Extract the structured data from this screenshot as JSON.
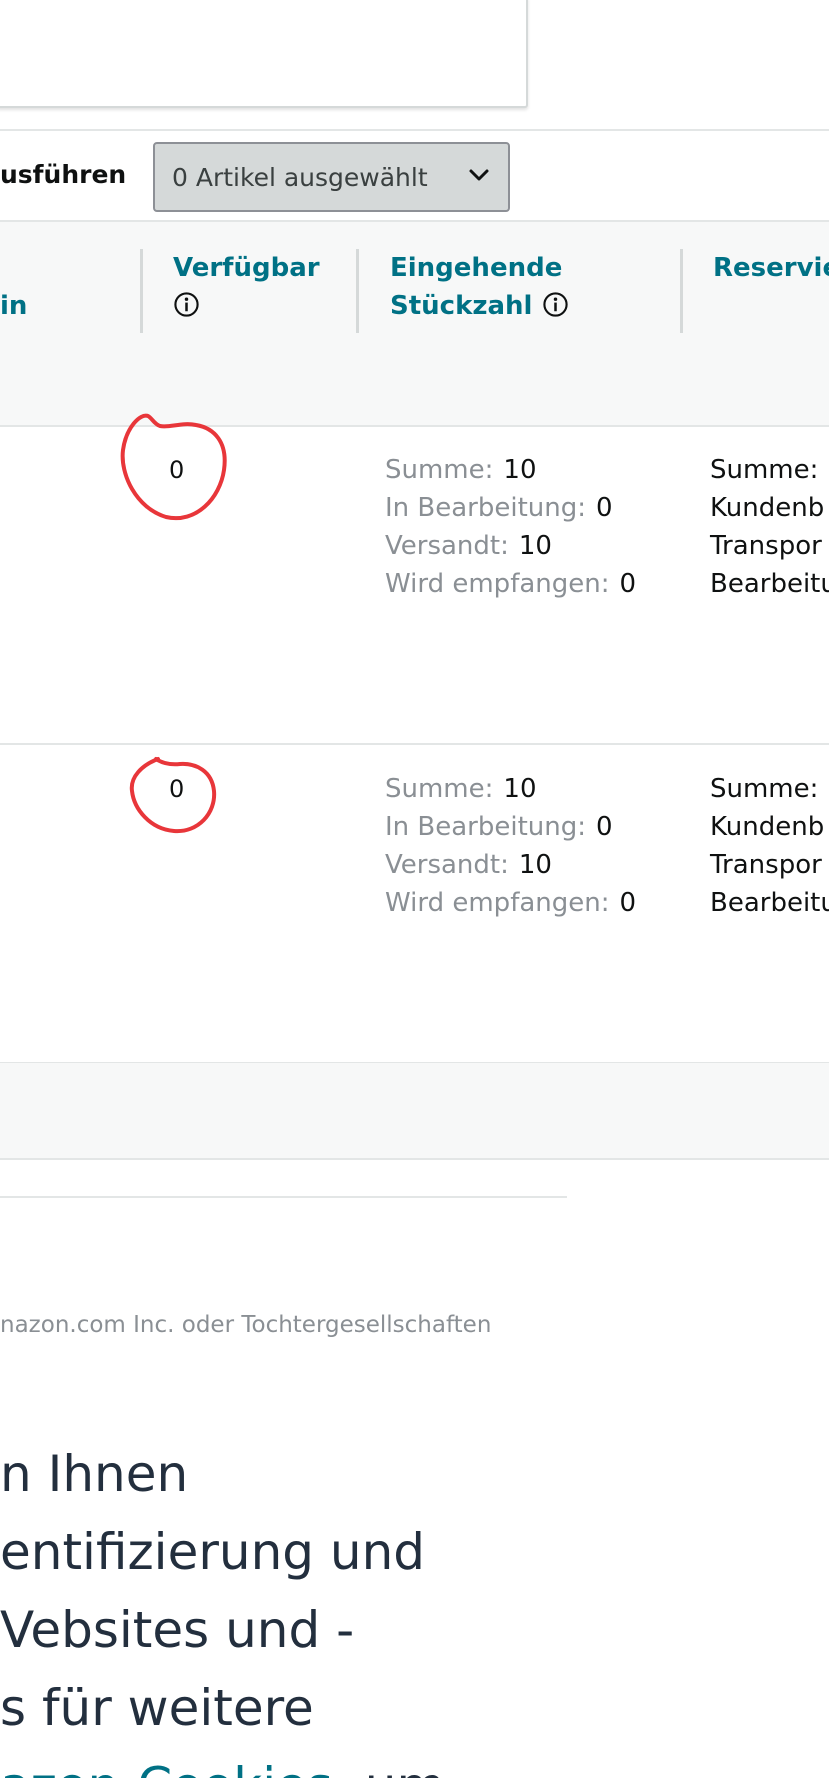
{
  "bulk_actions": {
    "label": "usführen",
    "select_value": "0 Artikel ausgewählt"
  },
  "table": {
    "headers": {
      "cut_left": "in",
      "available": "Verfügbar",
      "inbound_line1": "Eingehende",
      "inbound_line2": "Stückzahl",
      "reserved": "Reservie"
    },
    "rows": [
      {
        "available": "0",
        "inbound": [
          {
            "label": "Summe:",
            "value": "10"
          },
          {
            "label": "In Bearbeitung:",
            "value": "0"
          },
          {
            "label": "Versandt:",
            "value": "10"
          },
          {
            "label": "Wird empfangen:",
            "value": "0"
          }
        ],
        "reserved": [
          "Summe:",
          "Kundenb",
          "Transpor",
          "Bearbeitu"
        ]
      },
      {
        "available": "0",
        "inbound": [
          {
            "label": "Summe:",
            "value": "10"
          },
          {
            "label": "In Bearbeitung:",
            "value": "0"
          },
          {
            "label": "Versandt:",
            "value": "10"
          },
          {
            "label": "Wird empfangen:",
            "value": "0"
          }
        ],
        "reserved": [
          "Summe:",
          "Kundenb",
          "Transpor",
          "Bearbeitu"
        ]
      }
    ]
  },
  "footer": {
    "copyright": "nazon.com Inc. oder Tochtergesellschaften"
  },
  "cookie_notice": {
    "lines": [
      "n Ihnen",
      "entifizierung und",
      "Vebsites und -",
      "s für weitere"
    ],
    "link_text": "azon-Cookies",
    "after_link": ", um"
  },
  "colors": {
    "link": "#007185",
    "annotation": "#e8363a",
    "header_bg": "#f7f8f8",
    "select_bg": "#d5d9d9"
  },
  "icons": [
    "info-icon",
    "chevron-down-icon"
  ]
}
